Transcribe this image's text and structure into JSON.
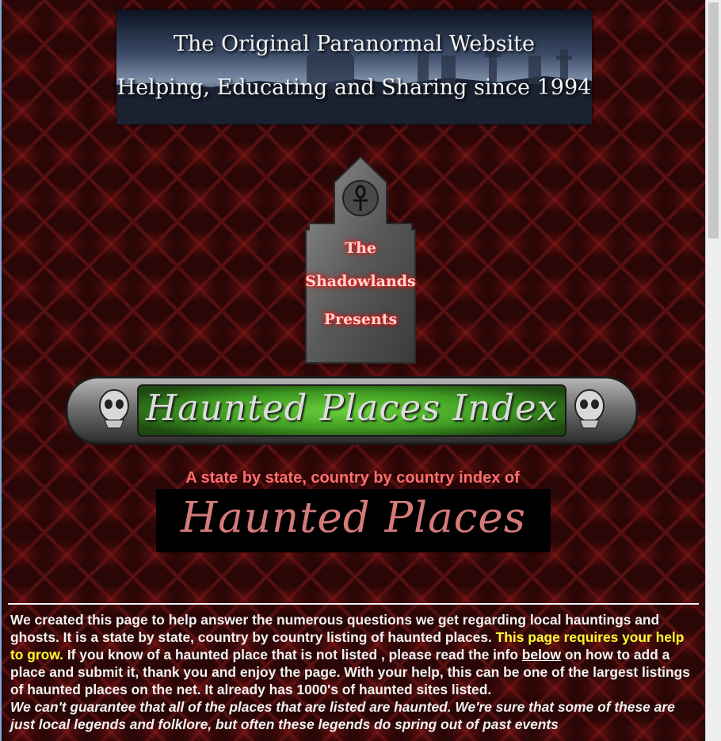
{
  "top_banner": {
    "line1": "The Original Paranormal Website",
    "line2": "Helping, Educating and Sharing since 1994"
  },
  "tombstone": {
    "line1": "The",
    "line2": "Shadowlands",
    "line3": "Presents",
    "symbol": "ankh-icon"
  },
  "index_banner": {
    "title": "Haunted Places Index",
    "ornament": "skull-icon"
  },
  "subtitle": "A state by state, country by country index of",
  "script_title": "Haunted Places",
  "intro": {
    "part1": "We created this page to help answer the numerous questions we get regarding local hauntings and ghosts.  It is a state by state, country by country listing of haunted places.  ",
    "highlight": "This page requires your help to grow.",
    "part2": "  If you know of a haunted place that is not listed , please read the info ",
    "link_below": "below",
    "part3": " on how to add a place and submit it, thank you and enjoy the page.  With your help, this can be one of the largest listings of haunted places on the net.  It already has 1000's of haunted sites listed.",
    "disclaimer": "We can't guarantee that all of the places that are listed are haunted.  We're sure that some of these are just local legends and folklore, but often these legends do spring out of past events"
  },
  "colors": {
    "background": "#2a0606",
    "highlight": "#ffff33",
    "subtitle": "#ff6e6e",
    "script": "#d57a7a",
    "index_green": "#4fb82a"
  }
}
